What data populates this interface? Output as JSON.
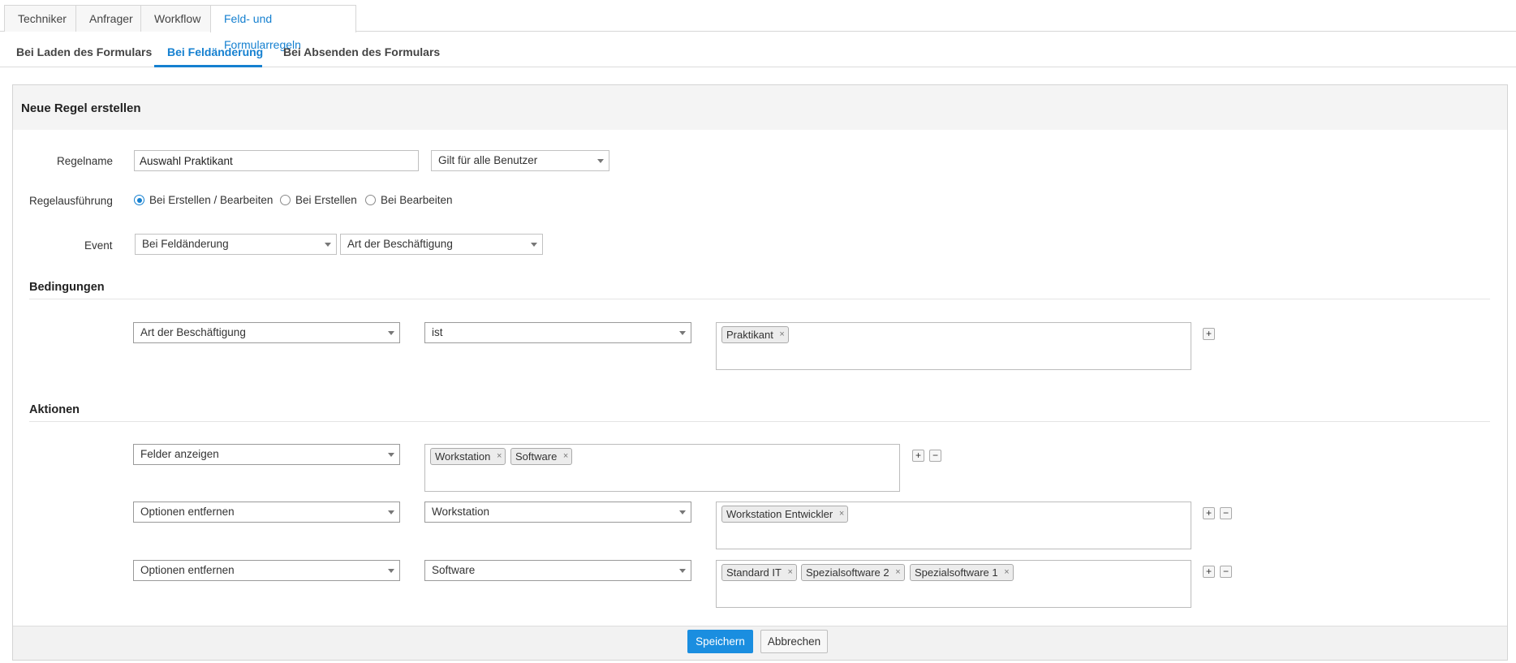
{
  "top_tabs": [
    "Techniker",
    "Anfrager",
    "Workflow",
    "Feld- und Formularregeln"
  ],
  "sub_tabs": [
    "Bei Laden des Formulars",
    "Bei Feldänderung",
    "Bei Absenden des Formulars"
  ],
  "panel": {
    "title": "Neue Regel erstellen",
    "rule_name_label": "Regelname",
    "rule_name_value": "Auswahl Praktikant",
    "applies_to": "Gilt für alle Benutzer",
    "execution_label": "Regelausführung",
    "execution_options": [
      "Bei Erstellen / Bearbeiten",
      "Bei Erstellen",
      "Bei Bearbeiten"
    ],
    "execution_selected": "Bei Erstellen / Bearbeiten",
    "event_label": "Event",
    "event_type": "Bei Feldänderung",
    "event_field": "Art der Beschäftigung"
  },
  "conditions": {
    "title": "Bedingungen",
    "field": "Art der Beschäftigung",
    "operator": "ist",
    "values": [
      "Praktikant"
    ]
  },
  "actions": {
    "title": "Aktionen",
    "rows": [
      {
        "action": "Felder anzeigen",
        "values": [
          "Workstation",
          "Software"
        ]
      },
      {
        "action": "Optionen entfernen",
        "field": "Workstation",
        "values": [
          "Workstation Entwickler"
        ]
      },
      {
        "action": "Optionen entfernen",
        "field": "Software",
        "values": [
          "Standard IT",
          "Spezialsoftware 2",
          "Spezialsoftware 1"
        ]
      }
    ]
  },
  "buttons": {
    "save": "Speichern",
    "cancel": "Abbrechen"
  },
  "colors": {
    "accent": "#1580d0",
    "primary_button": "#1a8ee0"
  },
  "icons": {
    "remove_tag": "×",
    "add": "+",
    "remove_row": "−"
  }
}
